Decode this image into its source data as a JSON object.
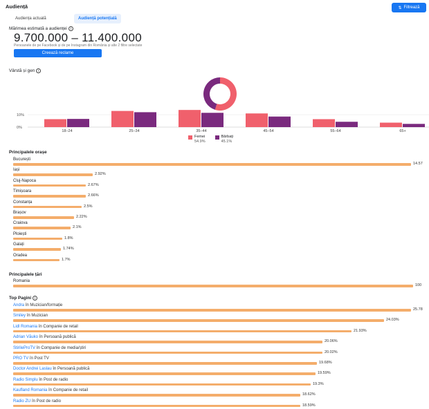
{
  "header": {
    "title": "Audiență",
    "filter_label": "Filtrează"
  },
  "tabs": [
    {
      "label": "Audiența actuală",
      "active": false
    },
    {
      "label": "Audiență potențială",
      "active": true
    }
  ],
  "estimate": {
    "label": "Mărimea estimată a audienței",
    "range": "9.700.000 – 11.400.000",
    "note": "Persoanele de pe Facebook și de pe Instagram din România și alte 2 filtre selectate",
    "create_button": "Creează reclame"
  },
  "age_gender": {
    "title": "Vârstă și gen",
    "legend": [
      {
        "name": "Femei",
        "percent": "54.9%",
        "color": "#f0606c"
      },
      {
        "name": "Bărbați",
        "percent": "45.1%",
        "color": "#7a2a7e"
      }
    ]
  },
  "chart_data": {
    "type": "bar",
    "categories": [
      "18–24",
      "25–34",
      "35–44",
      "45–54",
      "55–64",
      "65+"
    ],
    "series": [
      {
        "name": "Femei",
        "values": [
          6.4,
          13.0,
          13.8,
          11.0,
          6.4,
          3.6
        ],
        "color": "#f0606c"
      },
      {
        "name": "Bărbați",
        "values": [
          6.6,
          12.0,
          11.5,
          8.5,
          4.3,
          2.6
        ],
        "color": "#7a2a7e"
      }
    ],
    "yticks": [
      "10%",
      "0%"
    ],
    "ylim": [
      0,
      20
    ],
    "donut": {
      "women": 54.9,
      "men": 45.1
    }
  },
  "cities": {
    "title": "Principalele orașe",
    "items": [
      {
        "name": "București",
        "pct": "14.57",
        "value": 14.57
      },
      {
        "name": "Iași",
        "pct": "2.92%",
        "value": 2.92
      },
      {
        "name": "Cluj-Napoca",
        "pct": "2.67%",
        "value": 2.67
      },
      {
        "name": "Timișoara",
        "pct": "2.66%",
        "value": 2.66
      },
      {
        "name": "Constanța",
        "pct": "2.5%",
        "value": 2.5
      },
      {
        "name": "Brașov",
        "pct": "2.22%",
        "value": 2.22
      },
      {
        "name": "Craiova",
        "pct": "2.1%",
        "value": 2.1
      },
      {
        "name": "Ploiești",
        "pct": "1.8%",
        "value": 1.8
      },
      {
        "name": "Galați",
        "pct": "1.74%",
        "value": 1.74
      },
      {
        "name": "Oradea",
        "pct": "1.7%",
        "value": 1.7
      }
    ]
  },
  "countries": {
    "title": "Principalele țări",
    "items": [
      {
        "name": "Romania",
        "pct": "100",
        "value": 100
      }
    ]
  },
  "top_pages": {
    "title": "Top Pagini",
    "items": [
      {
        "name": "Andra",
        "category": "în Muzician/formație",
        "pct": "25.78",
        "value": 25.78
      },
      {
        "name": "Smiley",
        "category": "în Muzician",
        "pct": "24.03%",
        "value": 24.03
      },
      {
        "name": "Lidl Romania",
        "category": "în Companie de retail",
        "pct": "21.93%",
        "value": 21.93
      },
      {
        "name": "Adrian Văuko",
        "category": "în Persoană publică",
        "pct": "20.06%",
        "value": 20.06
      },
      {
        "name": "StirileProTV",
        "category": "în Companie de media/știri",
        "pct": "20.02%",
        "value": 20.02
      },
      {
        "name": "PRO TV",
        "category": "în Post TV",
        "pct": "19.68%",
        "value": 19.68
      },
      {
        "name": "Doctor Andrei Laslau",
        "category": "în Persoană publică",
        "pct": "19.59%",
        "value": 19.59
      },
      {
        "name": "Radio Simplu",
        "category": "în Post de radio",
        "pct": "19.3%",
        "value": 19.3
      },
      {
        "name": "Kaufland Romania",
        "category": "în Companie de retail",
        "pct": "18.62%",
        "value": 18.62
      },
      {
        "name": "Radio ZU",
        "category": "în Post de radio",
        "pct": "18.59%",
        "value": 18.59
      }
    ]
  }
}
